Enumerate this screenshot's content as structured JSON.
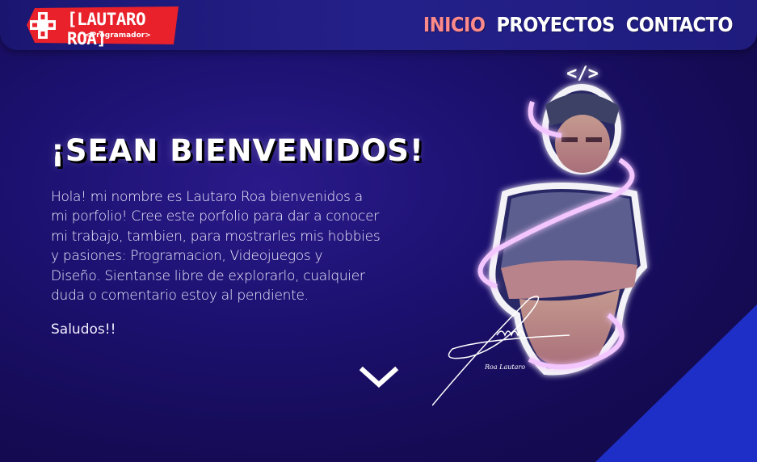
{
  "logo": {
    "title": "[LAUTARO ROA]",
    "subtitle": "<Programador>",
    "icon": "gamepad-cross-icon",
    "color": "#e8212b"
  },
  "nav": {
    "items": [
      {
        "label": "INICIO",
        "active": true
      },
      {
        "label": "PROYECTOS",
        "active": false
      },
      {
        "label": "CONTACTO",
        "active": false
      }
    ],
    "active_color": "#ff8a8a"
  },
  "hero": {
    "title": "¡SEAN BIENVENIDOS!",
    "lines": [
      "Hola! mi nombre es Lautaro Roa bienvenidos a",
      "mi porfolio! Cree este porfolio para dar a conocer",
      "mi trabajo, tambien, para mostrarles mis hobbies",
      "y pasiones: Programacion, Videojuegos y",
      "Diseño. Sientanse libre de explorarlo, cualquier",
      "duda o comentario estoy al pendiente."
    ],
    "greeting": "Saludos!!",
    "scroll_icon": "chevron-down-icon"
  },
  "portrait": {
    "code_tag": "</>",
    "signature": "Roa Lautaro"
  },
  "colors": {
    "background": "#1c1170",
    "header": "#24208a",
    "corner_accent": "#1e2fc7",
    "glow": "#e9a8ff"
  }
}
